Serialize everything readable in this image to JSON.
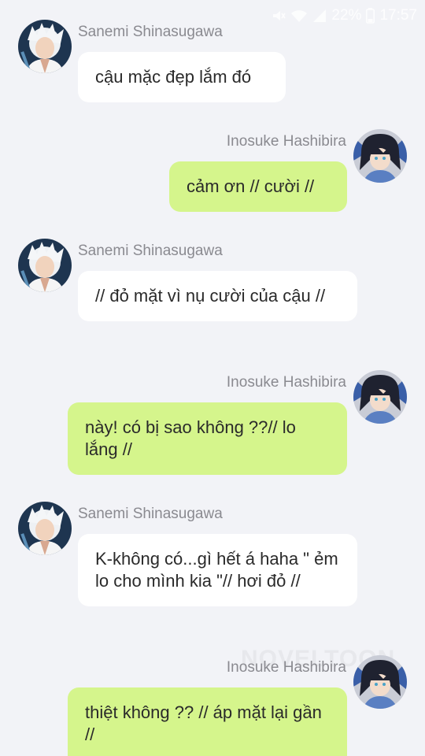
{
  "status_bar": {
    "battery": "22%",
    "time": "17:57",
    "icons": [
      "mute-icon",
      "wifi-icon",
      "signal-icon",
      "battery-icon"
    ]
  },
  "watermark": "NOVELTOON",
  "messages": [
    {
      "sender": "Sanemi Shinasugawa",
      "text": "cậu mặc đẹp lắm đó"
    },
    {
      "sender": "Inosuke Hashibira",
      "text": "cảm ơn // cười //"
    },
    {
      "sender": "Sanemi Shinasugawa",
      "text": "// đỏ mặt vì nụ cười của cậu //"
    },
    {
      "sender": "Inosuke Hashibira",
      "text": "này! có bị sao không ??// lo lắng //"
    },
    {
      "sender": "Sanemi Shinasugawa",
      "text": "K-không có...gì hết á haha \" ẻm lo cho mình kia \"// hơi đỏ //"
    },
    {
      "sender": "Inosuke Hashibira",
      "text": "thiệt không ?? // áp mặt lại gần //"
    }
  ],
  "colors": {
    "background": "#f2f3f7",
    "incoming_bubble": "#ffffff",
    "outgoing_bubble": "#d5f58c",
    "name_text": "#8a8a90"
  }
}
